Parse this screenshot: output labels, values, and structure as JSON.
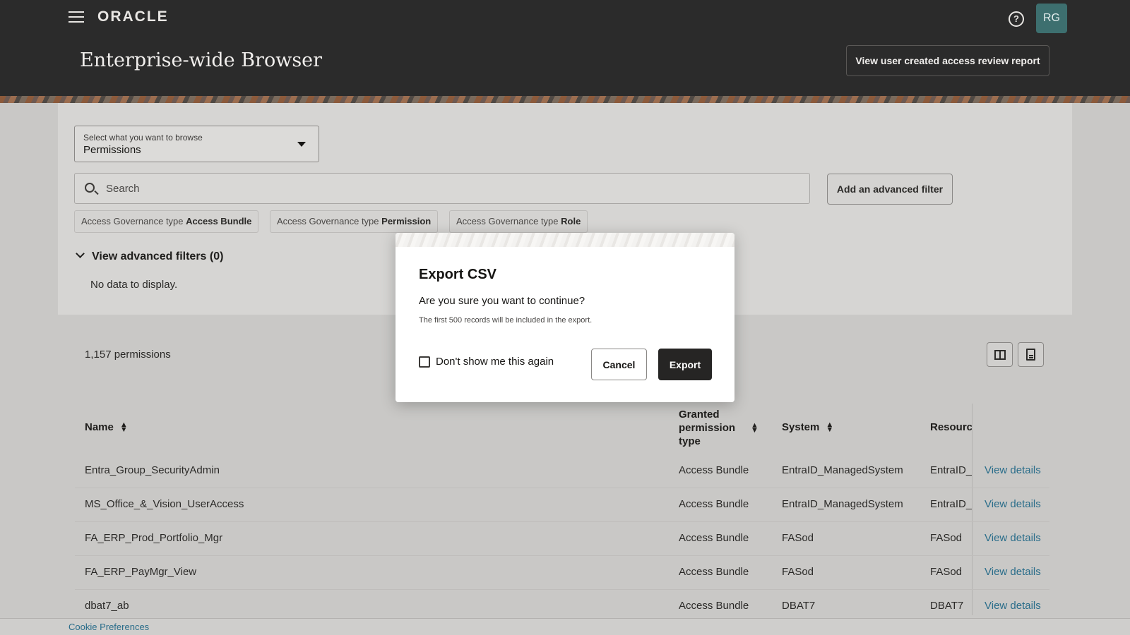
{
  "header": {
    "logo": "ORACLE",
    "title": "Enterprise-wide Browser",
    "avatar_initials": "RG",
    "help_icon": "question-circle-icon",
    "report_button": "View user created access review report"
  },
  "browse": {
    "select_label": "Select what you want to browse",
    "select_value": "Permissions",
    "search_placeholder": "Search",
    "advanced_filter_button": "Add an advanced filter",
    "chips": [
      {
        "prefix": "Access Governance type",
        "value": "Access Bundle"
      },
      {
        "prefix": "Access Governance type",
        "value": "Permission"
      },
      {
        "prefix": "Access Governance type",
        "value": "Role"
      }
    ],
    "advanced_filters_toggle": "View advanced filters (0)",
    "no_data": "No data to display."
  },
  "table": {
    "count": "1,157 permissions",
    "headers": {
      "name": "Name",
      "granted_line1": "Granted",
      "granted_line2": "permission",
      "granted_line3": "type",
      "system": "System",
      "resource": "Resourc"
    },
    "rows": [
      {
        "name": "Entra_Group_SecurityAdmin",
        "type": "Access Bundle",
        "system": "EntraID_ManagedSystem",
        "resource": "EntraID_",
        "action": "View details"
      },
      {
        "name": "MS_Office_&_Vision_UserAccess",
        "type": "Access Bundle",
        "system": "EntraID_ManagedSystem",
        "resource": "EntraID_",
        "action": "View details"
      },
      {
        "name": "FA_ERP_Prod_Portfolio_Mgr",
        "type": "Access Bundle",
        "system": "FASod",
        "resource": "FASod",
        "action": "View details"
      },
      {
        "name": "FA_ERP_PayMgr_View",
        "type": "Access Bundle",
        "system": "FASod",
        "resource": "FASod",
        "action": "View details"
      },
      {
        "name": "dbat7_ab",
        "type": "Access Bundle",
        "system": "DBAT7",
        "resource": "DBAT7",
        "action": "View details"
      }
    ]
  },
  "footer": {
    "cookie": "Cookie Preferences"
  },
  "modal": {
    "title": "Export CSV",
    "question": "Are you sure you want to continue?",
    "note": "The first 500 records will be included in the export.",
    "checkbox_label": "Don't show me this again",
    "cancel": "Cancel",
    "export": "Export"
  }
}
